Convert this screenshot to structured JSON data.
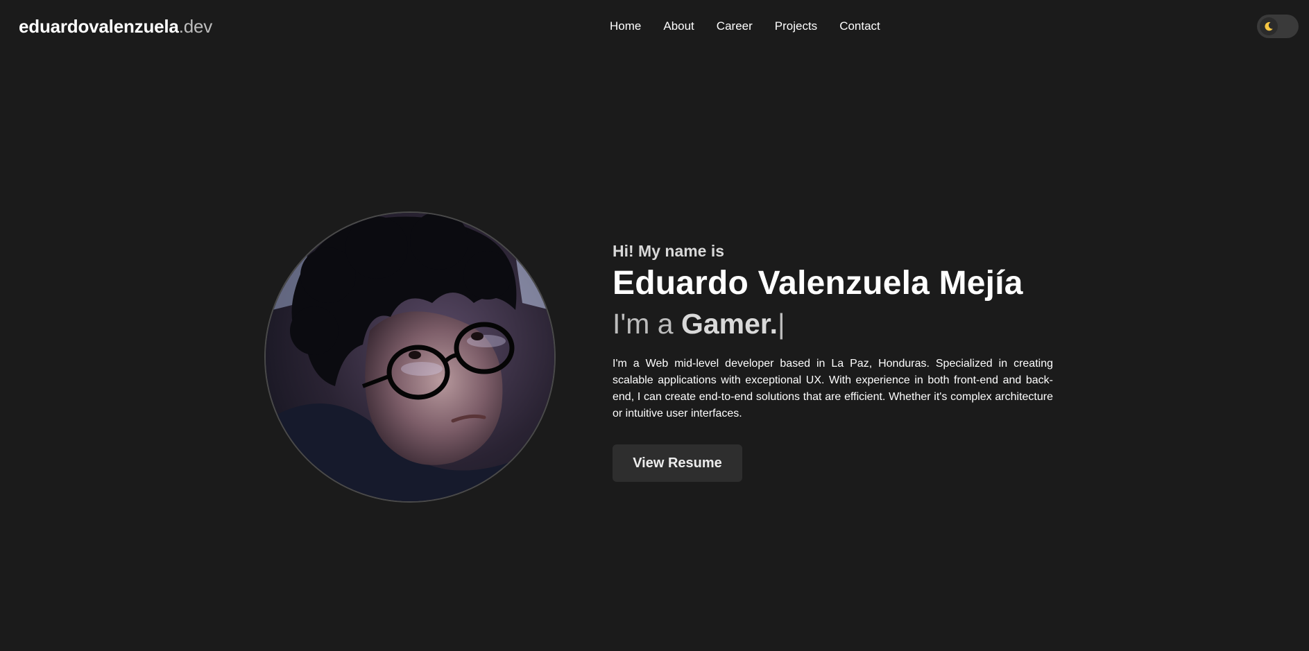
{
  "navbar": {
    "brand_main": "eduardovalenzuela",
    "brand_tld": ".dev",
    "links": [
      "Home",
      "About",
      "Career",
      "Projects",
      "Contact"
    ],
    "theme_toggle_icon": "moon-icon"
  },
  "hero": {
    "greeting": "Hi! My name is",
    "name": "Eduardo Valenzuela Mejía",
    "typed_prefix": "I'm a ",
    "typed_role": "Gamer.",
    "typed_cursor": "|",
    "bio": "I'm a Web mid-level developer based in La Paz, Honduras. Specialized in creating scalable applications with exceptional UX. With experience in both front-end and back-end, I can create end-to-end solutions that are efficient. Whether it's complex architecture or intuitive user interfaces.",
    "resume_button": "View Resume"
  },
  "colors": {
    "background": "#1b1b1b",
    "text": "#ffffff",
    "muted": "#bdbdbd",
    "button_bg": "#2e2e2e",
    "moon": "#f5c542"
  }
}
